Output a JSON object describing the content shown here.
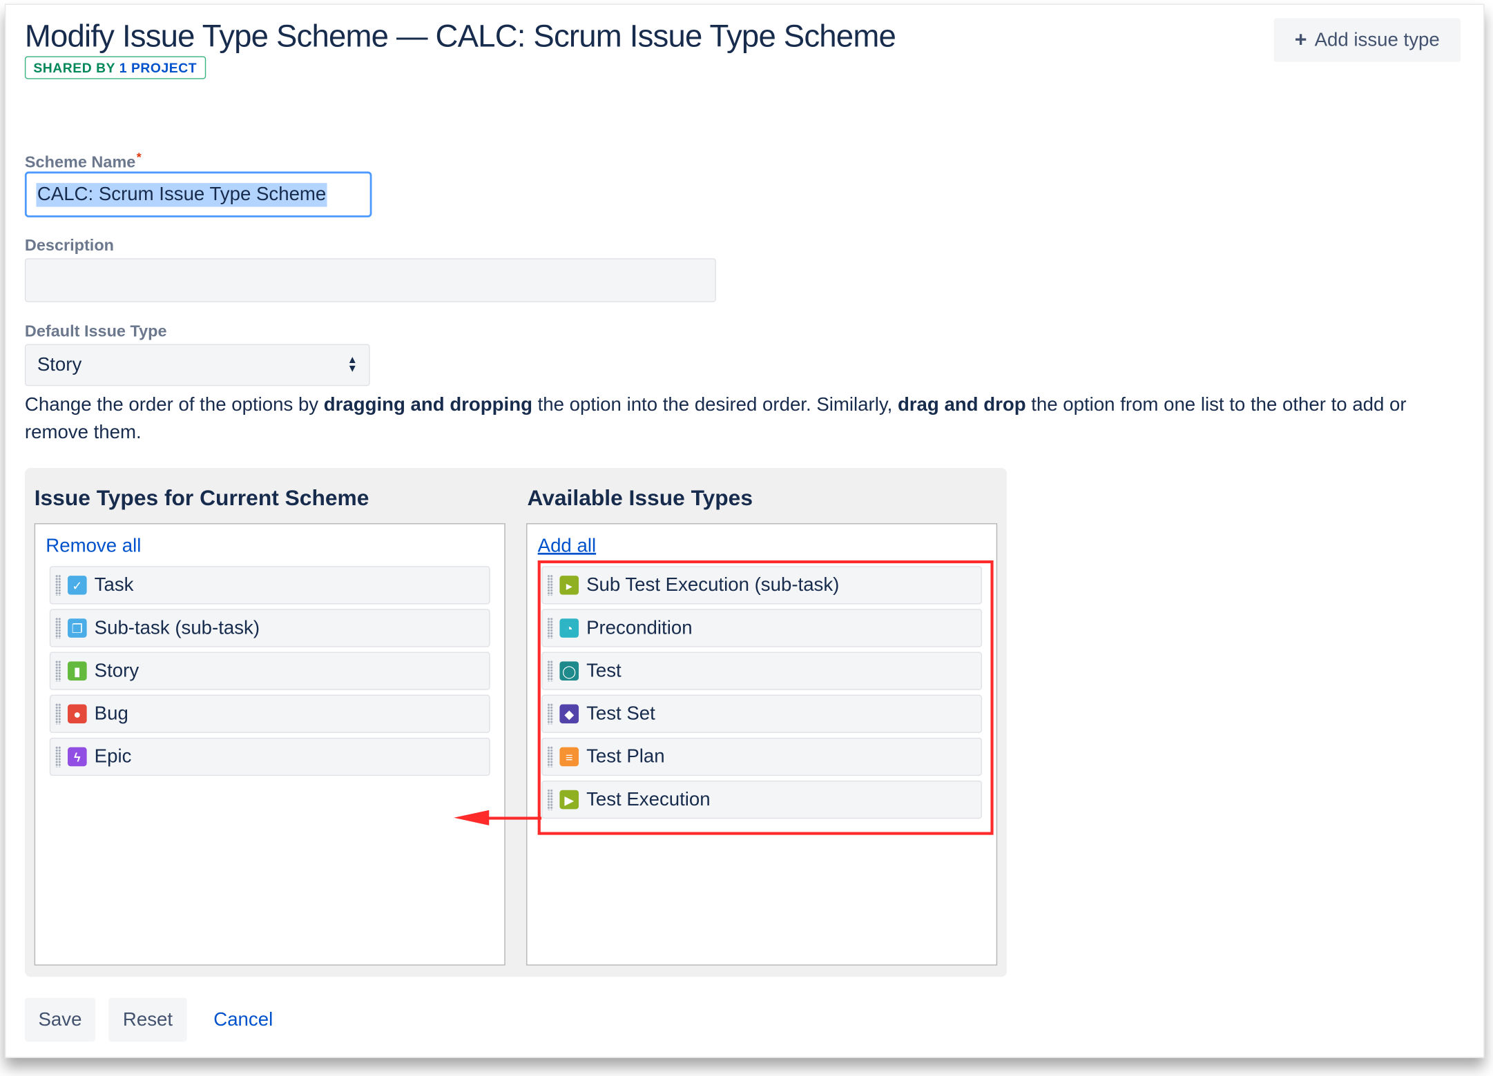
{
  "page": {
    "title": "Modify Issue Type Scheme — CALC: Scrum Issue Type Scheme",
    "shared_prefix": "SHARED BY",
    "shared_count": "1",
    "shared_suffix": "PROJECT",
    "add_issue_type_label": "Add issue type"
  },
  "form": {
    "scheme_name_label": "Scheme Name",
    "required_mark": "*",
    "scheme_name_value": "CALC: Scrum Issue Type Scheme",
    "description_label": "Description",
    "description_value": "",
    "default_issue_type_label": "Default Issue Type",
    "default_issue_type_value": "Story"
  },
  "instructions": {
    "part1": "Change the order of the options by ",
    "bold1": "dragging and dropping",
    "part2": " the option into the desired order. Similarly, ",
    "bold2": "drag and drop",
    "part3": " the option from one list to the other to add or remove them."
  },
  "current_scheme": {
    "heading": "Issue Types for Current Scheme",
    "action_label": "Remove all",
    "items": [
      {
        "label": "Task",
        "icon": "task-icon",
        "color": "#4bade8"
      },
      {
        "label": "Sub-task (sub-task)",
        "icon": "subtask-icon",
        "color": "#4bade8"
      },
      {
        "label": "Story",
        "icon": "story-icon",
        "color": "#63ba3c"
      },
      {
        "label": "Bug",
        "icon": "bug-icon",
        "color": "#e5493a"
      },
      {
        "label": "Epic",
        "icon": "epic-icon",
        "color": "#904ee2"
      }
    ]
  },
  "available": {
    "heading": "Available Issue Types",
    "action_label": "Add all",
    "items": [
      {
        "label": "Sub Test Execution (sub-task)",
        "icon": "sub-test-execution-icon",
        "color": "#8eb021"
      },
      {
        "label": "Precondition",
        "icon": "precondition-icon",
        "color": "#2eb5c5"
      },
      {
        "label": "Test",
        "icon": "test-icon",
        "color": "#1e8a8c"
      },
      {
        "label": "Test Set",
        "icon": "test-set-icon",
        "color": "#5243aa"
      },
      {
        "label": "Test Plan",
        "icon": "test-plan-icon",
        "color": "#f79232"
      },
      {
        "label": "Test Execution",
        "icon": "test-execution-icon",
        "color": "#8eb021"
      }
    ]
  },
  "buttons": {
    "save": "Save",
    "reset": "Reset",
    "cancel": "Cancel"
  },
  "annotation": {
    "highlight_color": "#ff2a2a"
  }
}
